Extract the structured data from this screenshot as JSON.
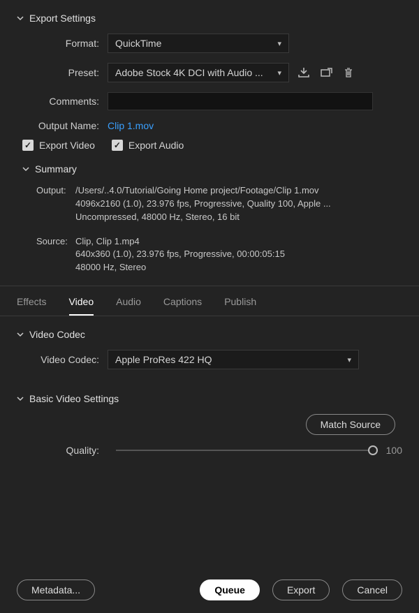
{
  "header": {
    "title": "Export Settings"
  },
  "format": {
    "label": "Format:",
    "value": "QuickTime"
  },
  "preset": {
    "label": "Preset:",
    "value": "Adobe Stock 4K DCI with Audio ..."
  },
  "comments": {
    "label": "Comments:",
    "value": ""
  },
  "outputName": {
    "label": "Output Name:",
    "value": "Clip 1.mov"
  },
  "checkboxes": {
    "exportVideo": "Export Video",
    "exportAudio": "Export Audio"
  },
  "summary": {
    "title": "Summary",
    "output": {
      "label": "Output:",
      "path": "/Users/..4.0/Tutorial/Going Home project/Footage/Clip 1.mov",
      "line2": "4096x2160 (1.0), 23.976 fps, Progressive, Quality 100, Apple ...",
      "line3": "Uncompressed, 48000 Hz, Stereo, 16 bit"
    },
    "source": {
      "label": "Source:",
      "line1": "Clip, Clip 1.mp4",
      "line2": "640x360 (1.0), 23.976 fps, Progressive, 00:00:05:15",
      "line3": "48000 Hz, Stereo"
    }
  },
  "tabs": {
    "effects": "Effects",
    "video": "Video",
    "audio": "Audio",
    "captions": "Captions",
    "publish": "Publish"
  },
  "videoCodec": {
    "section": "Video Codec",
    "label": "Video Codec:",
    "value": "Apple ProRes 422 HQ"
  },
  "basicVideo": {
    "section": "Basic Video Settings",
    "matchSource": "Match Source",
    "qualityLabel": "Quality:",
    "qualityValue": "100"
  },
  "buttons": {
    "metadata": "Metadata...",
    "queue": "Queue",
    "export": "Export",
    "cancel": "Cancel"
  }
}
